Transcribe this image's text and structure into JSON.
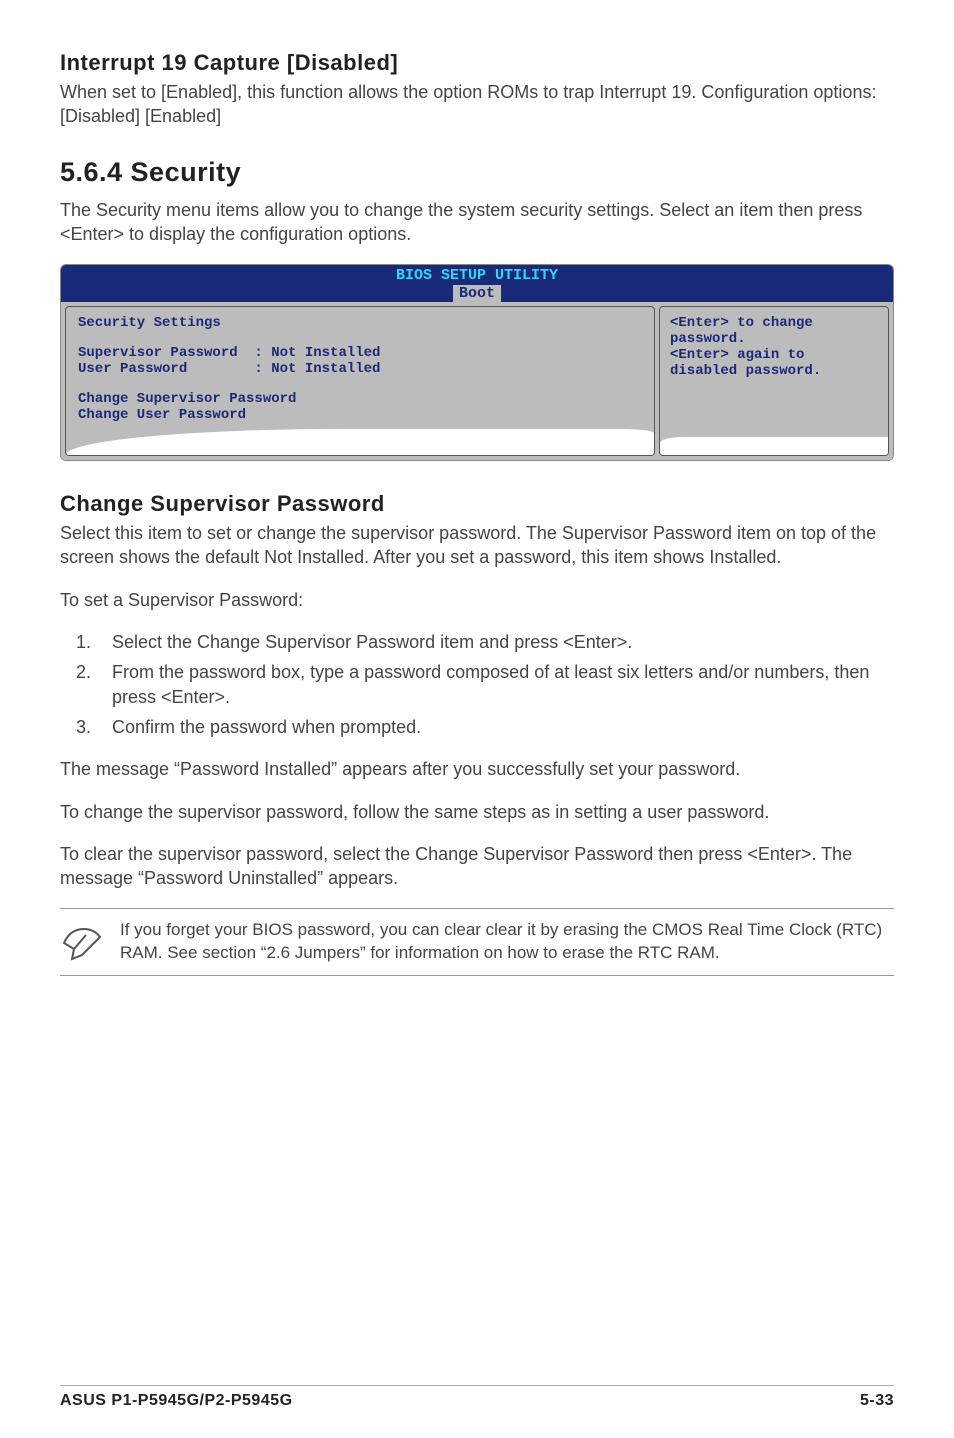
{
  "section1": {
    "heading": "Interrupt 19 Capture [Disabled]",
    "body": "When set to [Enabled], this function allows the option ROMs to trap Interrupt 19. Configuration options: [Disabled] [Enabled]"
  },
  "section2": {
    "heading": "5.6.4   Security",
    "intro": "The Security menu items allow you to change the system security settings. Select an item then press <Enter> to display the configuration options."
  },
  "bios": {
    "title": "BIOS SETUP UTILITY",
    "tab": "Boot",
    "left": {
      "heading": "Security Settings",
      "row1": "Supervisor Password  : Not Installed",
      "row2": "User Password        : Not Installed",
      "row3": "Change Supervisor Password",
      "row4": "Change User Password"
    },
    "right": {
      "line1": "<Enter> to change",
      "line2": "password.",
      "line3": "<Enter> again to",
      "line4": "disabled password."
    }
  },
  "section3": {
    "heading": "Change Supervisor Password",
    "p1": "Select this item to set or change the supervisor password. The Supervisor Password item on top of the screen shows the default Not Installed. After you set a password, this item shows Installed.",
    "p2": "To set a Supervisor Password:",
    "steps": [
      "Select the Change Supervisor Password item and press <Enter>.",
      "From the password box, type a password composed of at least six letters and/or numbers, then press <Enter>.",
      "Confirm the password when prompted."
    ],
    "p3": "The message “Password Installed” appears after you successfully set your password.",
    "p4": "To change the supervisor password, follow the same steps as in setting a user password.",
    "p5": "To clear the supervisor password, select the Change Supervisor Password then press <Enter>. The message “Password Uninstalled” appears."
  },
  "note": {
    "text": "If you forget your BIOS password, you can clear clear it by erasing the CMOS Real Time Clock (RTC) RAM. See section “2.6  Jumpers” for information on how to erase the RTC RAM."
  },
  "footer": {
    "left": "ASUS P1-P5945G/P2-P5945G",
    "right": "5-33"
  }
}
